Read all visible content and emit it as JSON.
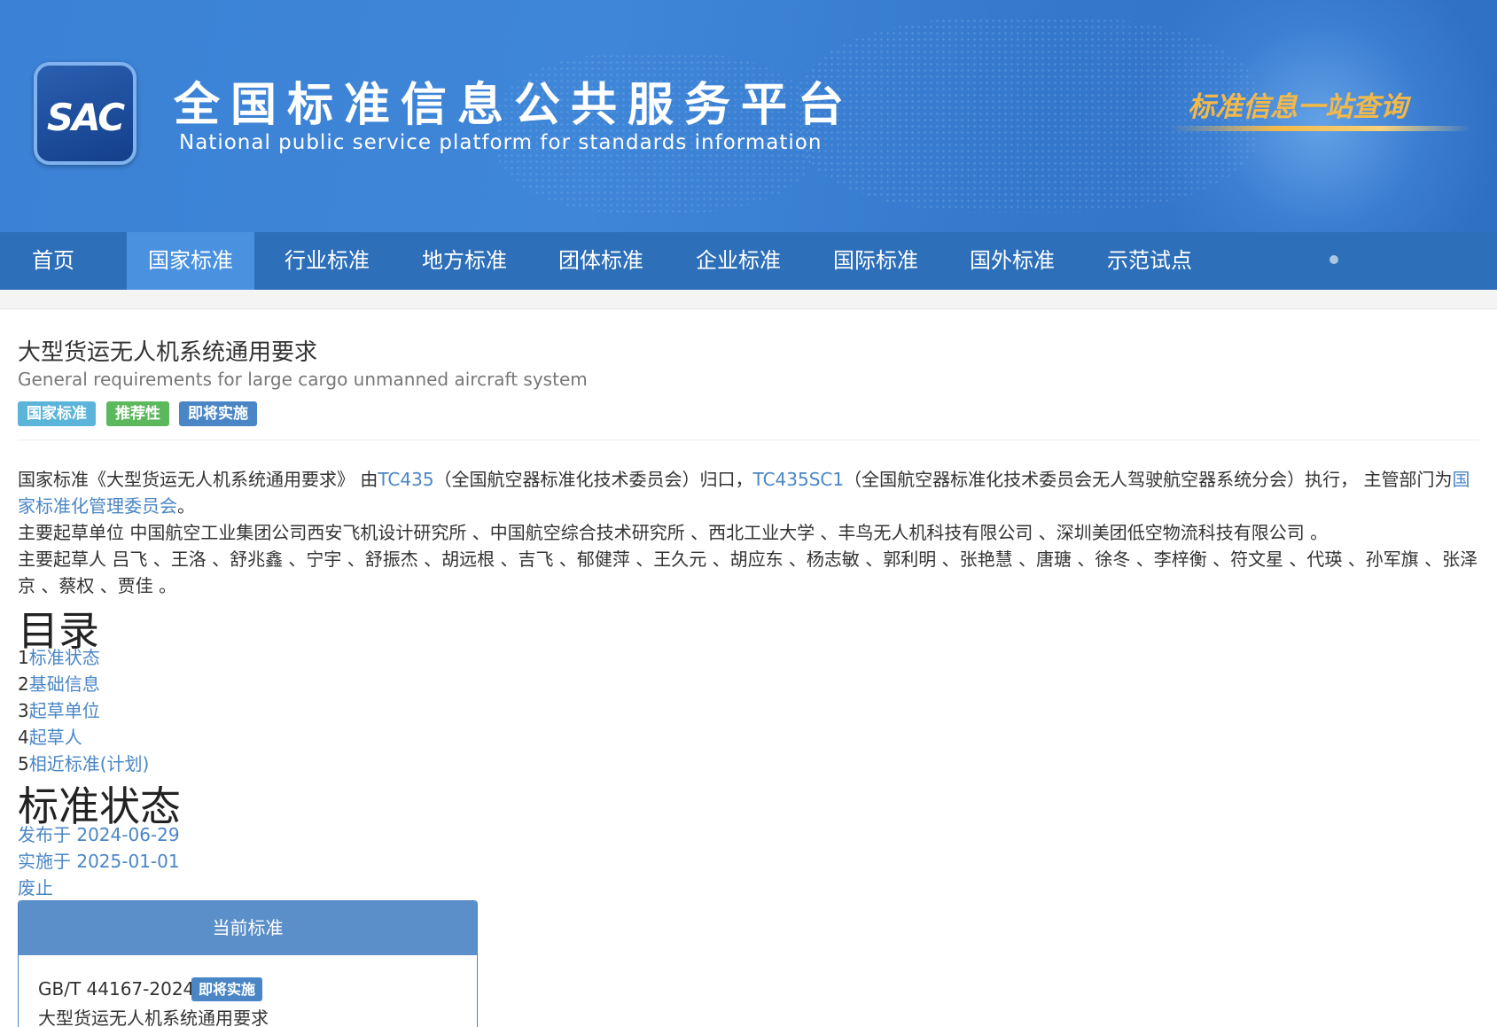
{
  "header": {
    "logo_text": "SAC",
    "title_cn": "全国标准信息公共服务平台",
    "title_en": "National public service platform  for standards information",
    "slogan": "标准信息一站查询"
  },
  "nav": {
    "items": [
      {
        "label": "首页"
      },
      {
        "label": "国家标准",
        "active": true
      },
      {
        "label": "行业标准"
      },
      {
        "label": "地方标准"
      },
      {
        "label": "团体标准"
      },
      {
        "label": "企业标准"
      },
      {
        "label": "国际标准"
      },
      {
        "label": "国外标准"
      },
      {
        "label": "示范试点"
      }
    ]
  },
  "standard": {
    "title": "大型货运无人机系统通用要求",
    "title_en": "General requirements for large cargo unmanned aircraft system",
    "badges": [
      {
        "label": "国家标准",
        "color": "#5bb5da"
      },
      {
        "label": "推荐性",
        "color": "#5cb85c"
      },
      {
        "label": "即将实施",
        "color": "#4a86c6"
      }
    ]
  },
  "description": {
    "p1_prefix": "国家标准《大型货运无人机系统通用要求》 由",
    "tc1": "TC435",
    "p1_mid1": "（全国航空器标准化技术委员会）归口，",
    "tc2": "TC435SC1",
    "p1_mid2": "（全国航空器标准化技术委员会无人驾驶航空器系统分会）执行， 主管部门为",
    "dept": "国家标准化管理委员会",
    "p1_end": "。",
    "drafting_units": "主要起草单位 中国航空工业集团公司西安飞机设计研究所 、中国航空综合技术研究所 、西北工业大学 、丰鸟无人机科技有限公司 、深圳美团低空物流科技有限公司 。",
    "drafters": "主要起草人 吕飞 、王洛 、舒兆鑫 、宁宇 、舒振杰 、胡远根 、吉飞 、郁健萍 、王久元 、胡应东 、杨志敏 、郭利明 、张艳慧 、唐瑭 、徐冬 、李梓衡 、符文星 、代瑛 、孙军旗 、张泽京 、蔡权 、贾佳 。"
  },
  "toc": {
    "heading": "目录",
    "items": [
      {
        "num": "1",
        "label": "标准状态"
      },
      {
        "num": "2",
        "label": "基础信息"
      },
      {
        "num": "3",
        "label": "起草单位"
      },
      {
        "num": "4",
        "label": "起草人"
      },
      {
        "num": "5",
        "label": "相近标准(计划)"
      }
    ]
  },
  "status": {
    "heading": "标准状态",
    "published": "发布于 2024-06-29",
    "effective": "实施于 2025-01-01",
    "abolished": "废止"
  },
  "current": {
    "heading": "当前标准",
    "code": "GB/T 44167-2024",
    "badge": "即将实施",
    "name": "大型货运无人机系统通用要求"
  }
}
